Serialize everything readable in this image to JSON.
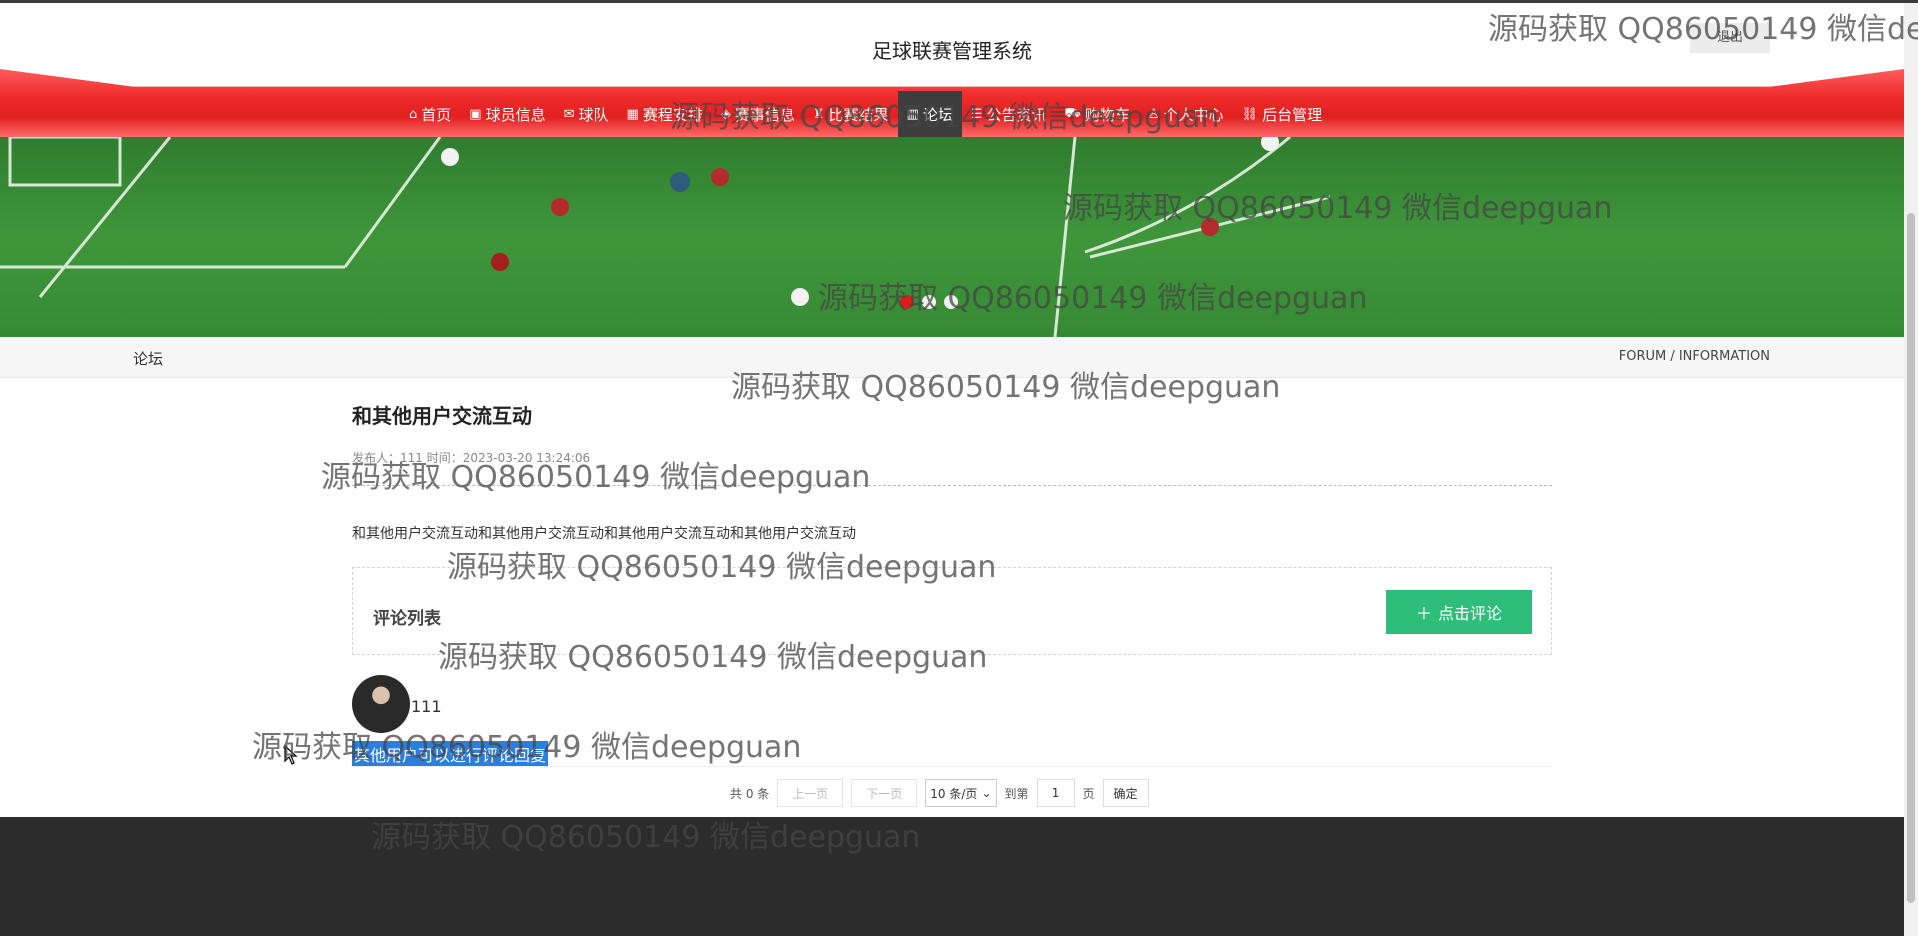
{
  "header": {
    "title": "足球联赛管理系统",
    "logout_label": "退出"
  },
  "nav": {
    "items": [
      {
        "label": "首页",
        "icon": "home-icon"
      },
      {
        "label": "球员信息",
        "icon": "gift-icon"
      },
      {
        "label": "球队",
        "icon": "mail-icon"
      },
      {
        "label": "赛程安排",
        "icon": "calendar-icon"
      },
      {
        "label": "赛事信息",
        "icon": "tag-icon"
      },
      {
        "label": "比赛结果",
        "icon": "trophy-icon"
      },
      {
        "label": "论坛",
        "icon": "forum-icon",
        "active": true
      },
      {
        "label": "公告资讯",
        "icon": "notice-icon"
      },
      {
        "label": "购物车",
        "icon": "cart-icon"
      },
      {
        "label": "个人中心",
        "icon": "user-icon"
      },
      {
        "label": "后台管理",
        "icon": "link-icon"
      }
    ]
  },
  "banner": {
    "slide_count": 3,
    "active_slide": 1
  },
  "breadcrumb": {
    "left": "论坛",
    "right": "FORUM / INFORMATION"
  },
  "post": {
    "title": "和其他用户交流互动",
    "meta": "发布人：111 时间：2023-03-20 13:24:06",
    "content": "和其他用户交流互动和其他用户交流互动和其他用户交流互动和其他用户交流互动"
  },
  "comments": {
    "section_label": "评论列表",
    "add_button_label": "点击评论",
    "items": [
      {
        "user": "111",
        "text": "其他用户可以进行评论回复"
      }
    ]
  },
  "pagination": {
    "total_text": "共 0 条",
    "prev_label": "上一页",
    "next_label": "下一页",
    "page_size": "10 条/页",
    "goto_label": "到第",
    "page_value": "1",
    "page_unit": "页",
    "confirm_label": "确定"
  },
  "watermark": "源码获取 QQ86050149 微信deepguan",
  "colors": {
    "nav_red": "#e11f1f",
    "nav_active": "#3d3d3d",
    "button_green": "#2ebd7a",
    "selection_blue": "#2a7de1",
    "footer": "#2c2c2c"
  }
}
